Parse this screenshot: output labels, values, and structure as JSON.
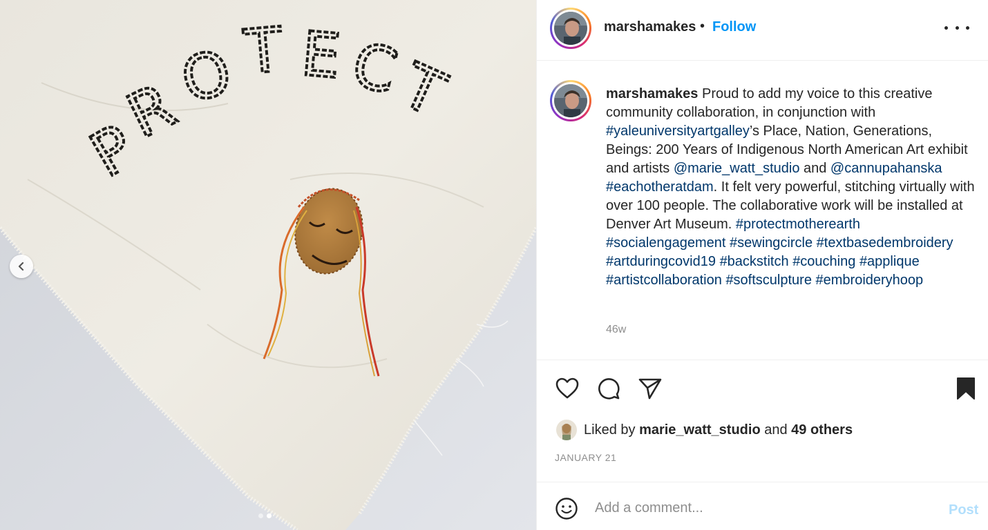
{
  "photo": {
    "embroidered_text": "PROTECT",
    "carousel": {
      "slide_count": 2,
      "active_index": 1
    }
  },
  "header": {
    "username": "marshamakes",
    "separator": "•",
    "follow_label": "Follow"
  },
  "caption": {
    "segments": [
      {
        "text": "marshamakes",
        "kind": "username"
      },
      {
        "text": " Proud to add my voice to this creative community collaboration, in conjunction with ",
        "kind": "text"
      },
      {
        "text": "#yaleuniversityartgalley",
        "kind": "tag"
      },
      {
        "text": "’s Place, Nation, Generations, Beings: 200 Years of Indigenous North American Art exhibit and artists ",
        "kind": "text"
      },
      {
        "text": "@marie_watt_studio",
        "kind": "tag"
      },
      {
        "text": " and ",
        "kind": "text"
      },
      {
        "text": "@cannupahanska",
        "kind": "tag"
      },
      {
        "text": " ",
        "kind": "text"
      },
      {
        "text": "#eachotheratdam",
        "kind": "tag"
      },
      {
        "text": ". It felt very powerful, stitching virtually with over 100 people. The collaborative work will be installed at Denver Art Museum. ",
        "kind": "text"
      },
      {
        "text": "#protectmotherearth",
        "kind": "tag"
      },
      {
        "text": " ",
        "kind": "text"
      },
      {
        "text": "#socialengagement",
        "kind": "tag"
      },
      {
        "text": " ",
        "kind": "text"
      },
      {
        "text": "#sewingcircle",
        "kind": "tag"
      },
      {
        "text": " ",
        "kind": "text"
      },
      {
        "text": "#textbasedembroidery",
        "kind": "tag"
      },
      {
        "text": " ",
        "kind": "text"
      },
      {
        "text": "#artduringcovid19",
        "kind": "tag"
      },
      {
        "text": " ",
        "kind": "text"
      },
      {
        "text": "#backstitch",
        "kind": "tag"
      },
      {
        "text": " ",
        "kind": "text"
      },
      {
        "text": "#couching",
        "kind": "tag"
      },
      {
        "text": " ",
        "kind": "text"
      },
      {
        "text": "#applique",
        "kind": "tag"
      },
      {
        "text": " ",
        "kind": "text"
      },
      {
        "text": "#artistcollaboration",
        "kind": "tag"
      },
      {
        "text": " ",
        "kind": "text"
      },
      {
        "text": "#softsculpture",
        "kind": "tag"
      },
      {
        "text": " ",
        "kind": "text"
      },
      {
        "text": "#embroideryhoop",
        "kind": "tag"
      }
    ],
    "time_ago": "46w"
  },
  "actions": {
    "icons": [
      "heart-icon",
      "comment-icon",
      "share-icon",
      "bookmark-icon"
    ]
  },
  "likes": {
    "prefix": "Liked by ",
    "user": "marie_watt_studio",
    "middle": " and ",
    "others": "49 others"
  },
  "date": "JANUARY 21",
  "comment": {
    "placeholder": "Add a comment...",
    "post_label": "Post"
  },
  "colors": {
    "link_blue": "#0095f6",
    "tag_blue": "#00376b",
    "muted_gray": "#8e8e8e",
    "post_disabled": "#b2dffc",
    "text": "#262626"
  }
}
